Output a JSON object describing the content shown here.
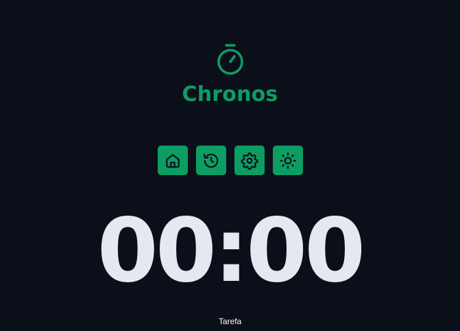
{
  "app": {
    "title": "Chronos",
    "logo_icon": "stopwatch-icon",
    "accent_color": "#0d9d63",
    "background_color": "#0b0f1a"
  },
  "menu": {
    "items": [
      {
        "icon": "home-icon",
        "name": "home"
      },
      {
        "icon": "history-icon",
        "name": "history"
      },
      {
        "icon": "settings-icon",
        "name": "settings"
      },
      {
        "icon": "sun-icon",
        "name": "theme"
      }
    ]
  },
  "timer": {
    "display": "00:00"
  },
  "task": {
    "label": "Tarefa"
  }
}
